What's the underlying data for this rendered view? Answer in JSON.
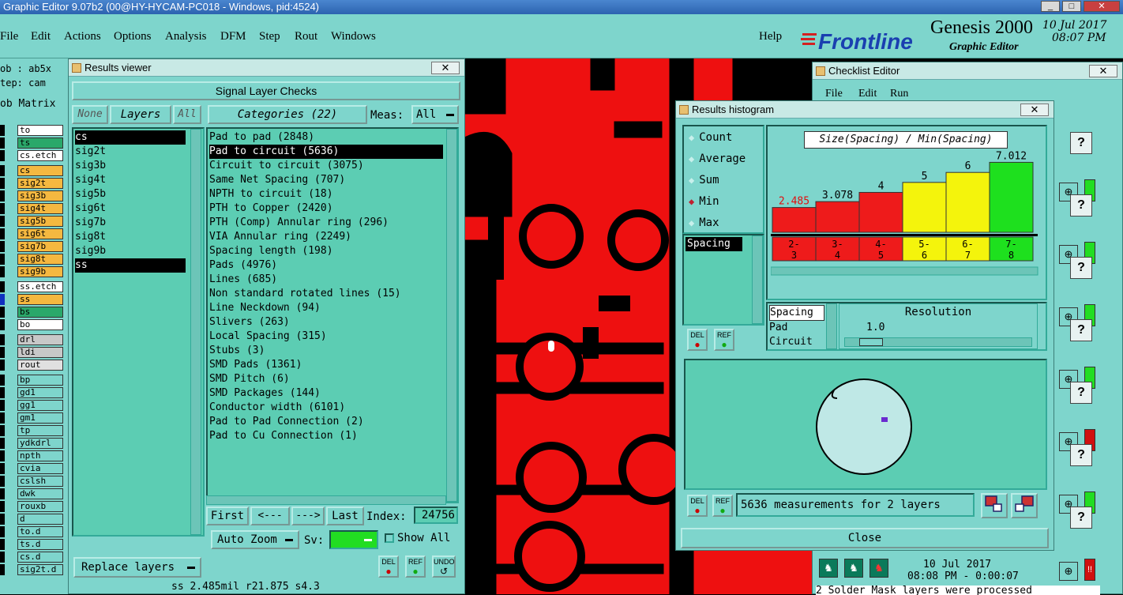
{
  "window": {
    "title": "Graphic Editor 9.07b2 (00@HY-HYCAM-PC018 - Windows, pid:4524)"
  },
  "menu": {
    "items": [
      "File",
      "Edit",
      "Actions",
      "Options",
      "Analysis",
      "DFM",
      "Step",
      "Rout",
      "Windows"
    ],
    "help": "Help"
  },
  "brand": {
    "logo": "Frontline",
    "product": "Genesis 2000",
    "subtitle": "Graphic Editor",
    "date": "10 Jul 2017",
    "time": "08:07 PM"
  },
  "left": {
    "job": "ob : ab5x",
    "step": "tep: cam",
    "matrix": "ob Matrix",
    "rows": [
      {
        "label": "to",
        "color": "#ffffff"
      },
      {
        "label": "ts",
        "color": "#2aa86a"
      },
      {
        "label": "cs.etch",
        "color": "#ffffff"
      },
      {
        "label": "cs",
        "color": "#f5b840"
      },
      {
        "label": "sig2t",
        "color": "#f5b840"
      },
      {
        "label": "sig3b",
        "color": "#f5b840"
      },
      {
        "label": "sig4t",
        "color": "#f5b840"
      },
      {
        "label": "sig5b",
        "color": "#f5b840"
      },
      {
        "label": "sig6t",
        "color": "#f5b840"
      },
      {
        "label": "sig7b",
        "color": "#f5b840"
      },
      {
        "label": "sig8t",
        "color": "#f5b840"
      },
      {
        "label": "sig9b",
        "color": "#f5b840"
      },
      {
        "label": "ss.etch",
        "color": "#ffffff"
      },
      {
        "label": "ss",
        "color": "#f5b840"
      },
      {
        "label": "bs",
        "color": "#2aa86a"
      },
      {
        "label": "bo",
        "color": "#ffffff"
      },
      {
        "label": "drl",
        "color": "#c8c8c8"
      },
      {
        "label": "ldi",
        "color": "#c8c8c8"
      },
      {
        "label": "rout",
        "color": "#e0e0e0"
      },
      {
        "label": "bp",
        "color": "#7ed5cc"
      },
      {
        "label": "gd1",
        "color": "#7ed5cc"
      },
      {
        "label": "gg1",
        "color": "#7ed5cc"
      },
      {
        "label": "gm1",
        "color": "#7ed5cc"
      },
      {
        "label": "tp",
        "color": "#7ed5cc"
      },
      {
        "label": "ydkdrl",
        "color": "#7ed5cc"
      },
      {
        "label": "npth",
        "color": "#7ed5cc"
      },
      {
        "label": "cvia",
        "color": "#7ed5cc"
      },
      {
        "label": "cslsh",
        "color": "#7ed5cc"
      },
      {
        "label": "dwk",
        "color": "#7ed5cc"
      },
      {
        "label": "rouxb",
        "color": "#7ed5cc"
      },
      {
        "label": "d",
        "color": "#7ed5cc"
      },
      {
        "label": "to.d",
        "color": "#7ed5cc"
      },
      {
        "label": "ts.d",
        "color": "#7ed5cc"
      },
      {
        "label": "cs.d",
        "color": "#7ed5cc"
      },
      {
        "label": "sig2t.d",
        "color": "#7ed5cc"
      }
    ]
  },
  "results_viewer": {
    "title": "Results viewer",
    "heading": "Signal Layer Checks",
    "none_btn": "None",
    "layers_btn": "Layers",
    "all_btn": "All",
    "categories_btn": "Categories (22)",
    "meas_label": "Meas:",
    "meas_value": "All",
    "layers": [
      "cs",
      "sig2t",
      "sig3b",
      "sig4t",
      "sig5b",
      "sig6t",
      "sig7b",
      "sig8t",
      "sig9b",
      "ss"
    ],
    "categories": [
      "Pad to pad (2848)",
      "Pad to circuit (5636)",
      "Circuit to circuit (3075)",
      "Same Net Spacing (707)",
      "NPTH to circuit (18)",
      "PTH to Copper (2420)",
      "PTH (Comp) Annular ring (296)",
      "VIA Annular ring (2249)",
      "Spacing length (198)",
      "Pads (4976)",
      "Lines (685)",
      "Non standard rotated lines (15)",
      "Line Neckdown (94)",
      "Slivers (263)",
      "Local Spacing (315)",
      "Stubs (3)",
      "SMD Pads (1361)",
      "SMD Pitch (6)",
      "SMD Packages (144)",
      "Conductor width (6101)",
      "Pad to Pad Connection (2)",
      "Pad to Cu Connection (1)"
    ],
    "first": "First",
    "prev": "<---",
    "next": "--->",
    "last": "Last",
    "index_label": "Index:",
    "index_value": "24756",
    "auto_zoom": "Auto Zoom",
    "sv_label": "Sv:",
    "show_all": "Show All",
    "replace_layers": "Replace layers",
    "del": "DEL",
    "ref": "REF",
    "undo": "UNDO",
    "status": "ss 2.485mil  r21.875  s4.3"
  },
  "histogram": {
    "title": "Results histogram",
    "options": [
      "Count",
      "Average",
      "Sum",
      "Min",
      "Max"
    ],
    "selected_option": "Min",
    "measure_list": [
      "Spacing"
    ],
    "chart_title": "Size(Spacing) / Min(Spacing)",
    "chart_data": {
      "type": "bar",
      "title": "Size(Spacing) / Min(Spacing)",
      "categories": [
        "2-3",
        "3-4",
        "4-5",
        "5-6",
        "6-7",
        "7-8"
      ],
      "values": [
        2.485,
        3.078,
        4,
        5,
        6,
        7.012
      ],
      "value_labels": [
        "2.485",
        "3.078",
        "4",
        "5",
        "6",
        "7.012"
      ],
      "colors": [
        "#ee1b1b",
        "#ee1b1b",
        "#ee1b1b",
        "#f4f40c",
        "#f4f40c",
        "#1ee01e"
      ],
      "ylim": [
        0,
        7.6
      ]
    },
    "types": [
      "Spacing",
      "Pad",
      "Circuit"
    ],
    "resolution_label": "Resolution",
    "resolution_value": "1.0",
    "summary": "5636 measurements for 2 layers",
    "close": "Close",
    "del": "DEL",
    "ref": "REF"
  },
  "checklist": {
    "title": "Checklist Editor",
    "menu": [
      "File",
      "Edit",
      "Run"
    ],
    "last_time": "10 Jul 2017",
    "last_time2": "08:08 PM - 0:00:07",
    "message": "2 Solder Mask layers were processed"
  }
}
